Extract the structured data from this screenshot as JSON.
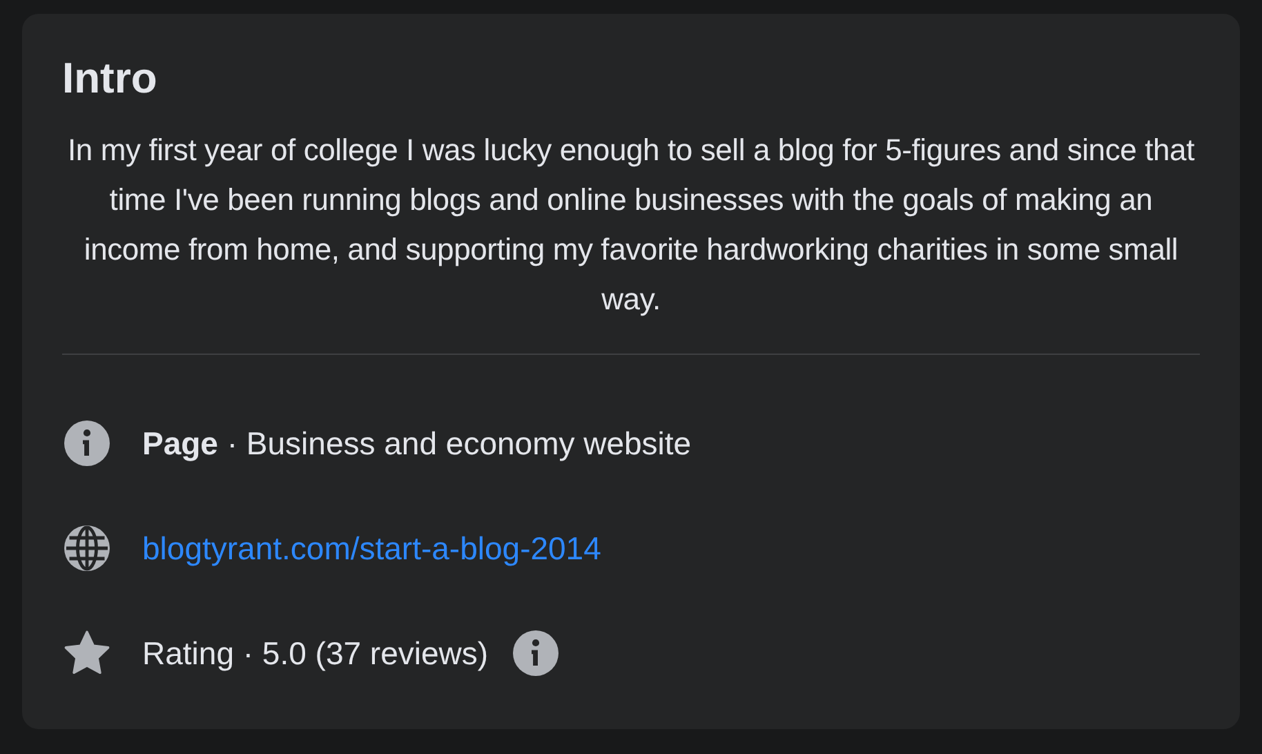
{
  "intro": {
    "title": "Intro",
    "bio": "In my first year of college I was lucky enough to sell a blog for 5-figures and since that time I've been running blogs and online businesses with the goals of making an income from home, and supporting my favorite hardworking charities in some small way."
  },
  "details": [
    {
      "kind": "category",
      "text": "**Page** · Business and economy website"
    },
    {
      "kind": "website",
      "text": "blogtyrant.com/start-a-blog-2014"
    },
    {
      "kind": "rating",
      "text": "Rating · 5.0 (37 reviews)"
    }
  ]
}
